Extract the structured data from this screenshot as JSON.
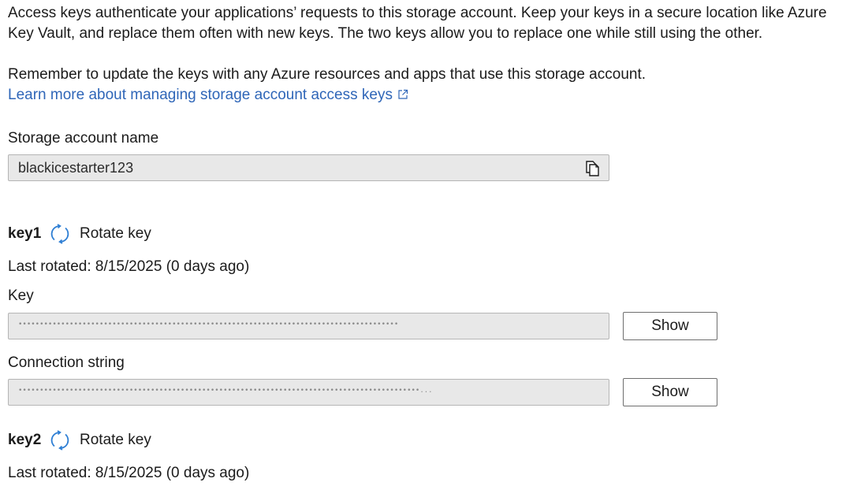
{
  "intro": {
    "line1": "Access keys authenticate your applications’ requests to this storage account. Keep your keys in a secure location like Azure",
    "line2": "Key Vault, and replace them often with new keys. The two keys allow you to replace one while still using the other."
  },
  "reminder": "Remember to update the keys with any Azure resources and apps that use this storage account.",
  "learn_more": {
    "label": "Learn more about managing storage account access keys",
    "icon": "external-link-icon"
  },
  "storage_account": {
    "label": "Storage account name",
    "value": "blackicestarter123",
    "copy_icon": "copy-icon"
  },
  "key1": {
    "title": "key1",
    "rotate_label": "Rotate key",
    "rotate_icon": "rotate-icon",
    "last_rotated": "Last rotated: 8/15/2025 (0 days ago)",
    "key_label": "Key",
    "key_mask": "•••••••••••••••••••••••••••••••••••••••••••••••••••••••••••••••••••••••••••••••••••••••••",
    "show_key_label": "Show",
    "connection_label": "Connection string",
    "connection_mask": "••••••••••••••••••••••••••••••••••••••••••••••••••••••••••••••••••••••••••••••••••••••••••••••...",
    "show_connection_label": "Show"
  },
  "key2": {
    "title": "key2",
    "rotate_label": "Rotate key",
    "rotate_icon": "rotate-icon",
    "last_rotated": "Last rotated: 8/15/2025 (0 days ago)"
  },
  "colors": {
    "link": "#2f66b8",
    "icon_blue": "#2f7fd4",
    "field_bg": "#e8e8e8"
  }
}
